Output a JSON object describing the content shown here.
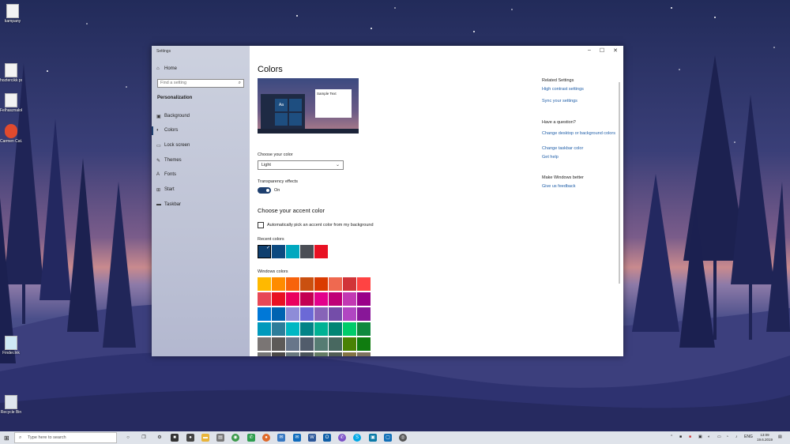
{
  "desktop": {
    "icons": [
      {
        "label": "kampany"
      },
      {
        "label": "hoztercikk\npolices.ci..."
      },
      {
        "label": "Felhasznalok\napril 29..."
      },
      {
        "label": "Carmen Cat..\nmacro ExW..."
      },
      {
        "label": "Finder.lnk"
      },
      {
        "label": "Recycle Bin"
      }
    ]
  },
  "window": {
    "title": "Settings",
    "controls": {
      "minimize": "–",
      "maximize": "☐",
      "close": "✕"
    }
  },
  "sidebar": {
    "home": "Home",
    "search_placeholder": "Find a setting",
    "section": "Personalization",
    "items": [
      {
        "label": "Background",
        "icon": "image-icon"
      },
      {
        "label": "Colors",
        "icon": "palette-icon"
      },
      {
        "label": "Lock screen",
        "icon": "lock-screen-icon"
      },
      {
        "label": "Themes",
        "icon": "brush-icon"
      },
      {
        "label": "Fonts",
        "icon": "font-icon"
      },
      {
        "label": "Start",
        "icon": "start-icon"
      },
      {
        "label": "Taskbar",
        "icon": "taskbar-icon"
      }
    ],
    "active_index": 1
  },
  "main": {
    "title": "Colors",
    "preview_sample": "Sample Text",
    "preview_tile": "Aa",
    "choose_color_label": "Choose your color",
    "choose_color_value": "Light",
    "transparency_label": "Transparency effects",
    "transparency_state": "On",
    "accent_heading": "Choose your accent color",
    "auto_pick_label": "Automatically pick an accent color from my background",
    "recent_label": "Recent colors",
    "recent_colors": [
      "#0f3f6e",
      "#0d4a80",
      "#00a8bf",
      "#4a4e55",
      "#e81123"
    ],
    "windows_label": "Windows colors",
    "windows_colors": [
      [
        "#ffb900",
        "#ff8c00",
        "#f7630c",
        "#ca5010",
        "#da3b01",
        "#ef6950",
        "#d13438",
        "#ff4343"
      ],
      [
        "#e74856",
        "#e81123",
        "#ea005e",
        "#c30052",
        "#e3008c",
        "#bf0077",
        "#c239b3",
        "#9a0089"
      ],
      [
        "#0078d7",
        "#0063b1",
        "#8e8cd8",
        "#6b69d6",
        "#8764b8",
        "#744da9",
        "#b146c2",
        "#881798"
      ],
      [
        "#0099bc",
        "#2d7d9a",
        "#00b7c3",
        "#038387",
        "#00b294",
        "#018574",
        "#00cc6a",
        "#10893e"
      ],
      [
        "#7a7574",
        "#5d5a58",
        "#68768a",
        "#515c6b",
        "#567c73",
        "#486860",
        "#498205",
        "#107c10"
      ],
      [
        "#767676",
        "#4c4a48",
        "#69797e",
        "#4a5459",
        "#647c64",
        "#525e54",
        "#847545",
        "#7e735f"
      ]
    ]
  },
  "related": {
    "heading1": "Related Settings",
    "link1": "High contrast settings",
    "link2": "Sync your settings",
    "heading2": "Have a question?",
    "link3": "Change desktop or background colors",
    "link4": "Change taskbar color",
    "link5": "Get help",
    "heading3": "Make Windows better",
    "link6": "Give us feedback"
  },
  "taskbar": {
    "search_placeholder": "Type here to search",
    "language": "ENG",
    "time": "13:09",
    "date": "19.6.2019"
  }
}
